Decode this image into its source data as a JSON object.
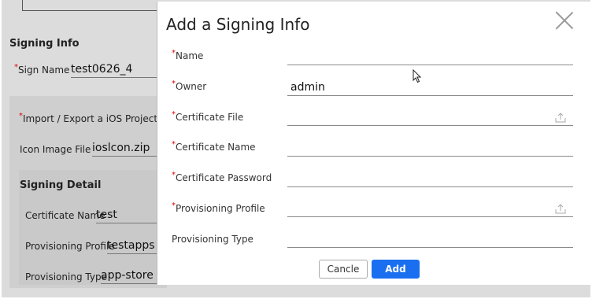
{
  "background": {
    "section_title": "Signing Info",
    "sign_name_label": "Sign Name",
    "sign_name_value": "test0626_4",
    "import_export_label": "Import / Export a iOS Project",
    "icon_image_label": "Icon Image File",
    "icon_image_value": "ioslcon.zip",
    "signing_detail_title": "Signing Detail",
    "certificate_name_label": "Certificate Name",
    "certificate_name_value": "test",
    "provisioning_profile_label": "Provisioning Profile",
    "provisioning_profile_value": "testapps",
    "provisioning_type_label": "Provisioning Type",
    "provisioning_type_value": "app-store"
  },
  "modal": {
    "title": "Add a Signing Info",
    "fields": [
      {
        "label": "Name",
        "required": true,
        "value": ""
      },
      {
        "label": "Owner",
        "required": true,
        "value": "admin"
      },
      {
        "label": "Certificate File",
        "required": true,
        "value": "",
        "upload": true
      },
      {
        "label": "Certificate Name",
        "required": true,
        "value": ""
      },
      {
        "label": "Certificate Password",
        "required": true,
        "value": ""
      },
      {
        "label": "Provisioning Profile",
        "required": true,
        "value": "",
        "upload": true
      },
      {
        "label": "Provisioning Type",
        "required": false,
        "value": ""
      }
    ],
    "cancel_label": "Cancle",
    "add_label": "Add",
    "required_mark": "*"
  },
  "colors": {
    "accent": "#1a6ff0",
    "required": "#dd0000",
    "overlay": "#dcdcdc"
  },
  "icons": {
    "close": "close-icon",
    "upload": "upload-icon"
  }
}
